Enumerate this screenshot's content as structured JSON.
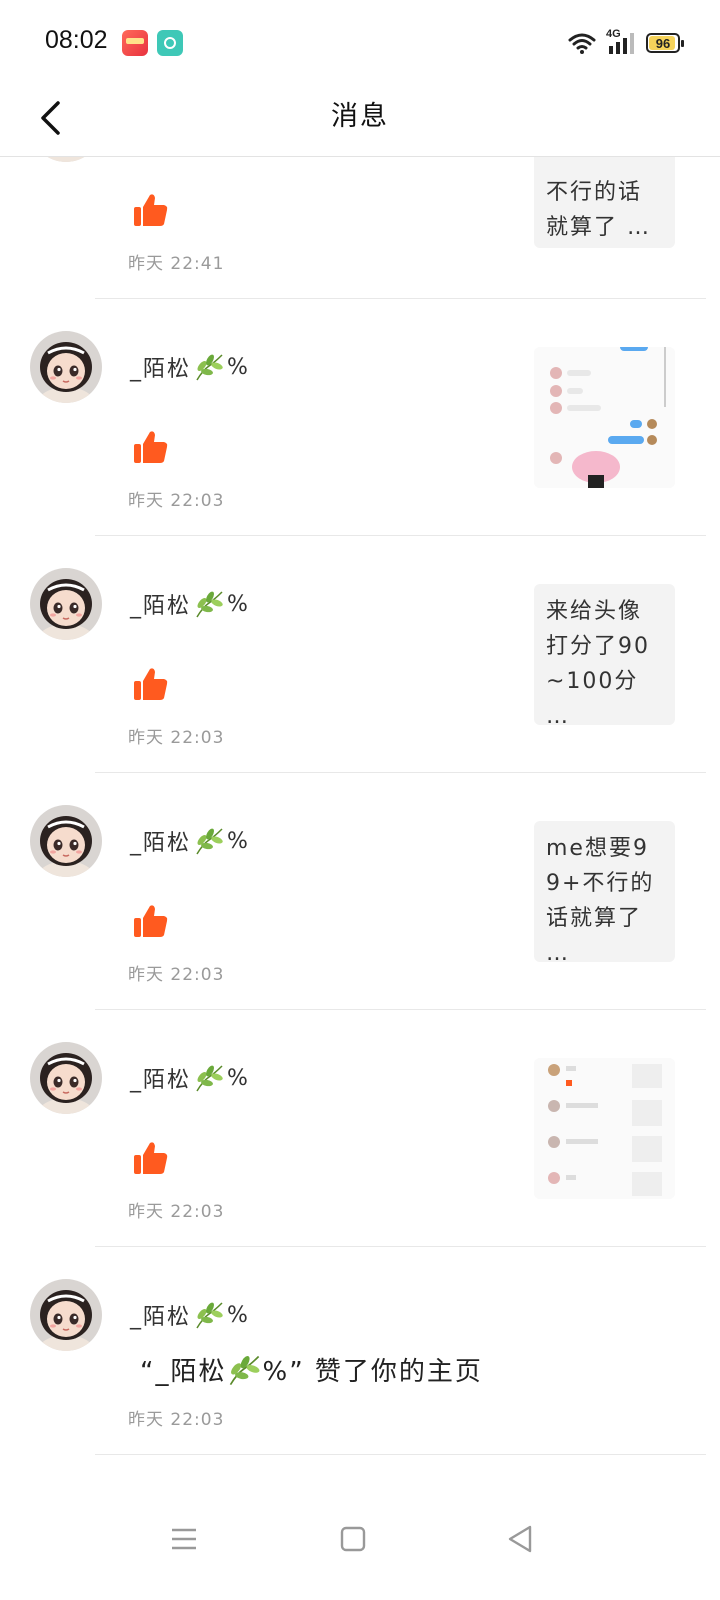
{
  "status_bar": {
    "time": "08:02",
    "network": "4G",
    "battery": "96",
    "icons": [
      "app-icon-1",
      "app-icon-2",
      "wifi-icon",
      "signal-icon",
      "battery-icon"
    ]
  },
  "header": {
    "title": "消息",
    "back_icon": "chevron-left-icon"
  },
  "username": "_陌松",
  "username_suffix": "%",
  "items": [
    {
      "time": "昨天 22:41",
      "thumb_text": "不行的话就算了 …",
      "like": true
    },
    {
      "time": "昨天 22:03",
      "thumb_type": "image",
      "like": true
    },
    {
      "time": "昨天 22:03",
      "thumb_text": "来给头像打分了90~100分 …",
      "like": true
    },
    {
      "time": "昨天 22:03",
      "thumb_text": "me想要99+不行的话就算了 …",
      "like": true
    },
    {
      "time": "昨天 22:03",
      "thumb_type": "image",
      "like": true
    },
    {
      "time": "昨天 22:03",
      "message_prefix": "“_陌松",
      "message_suffix": "%” 赞了你的主页"
    }
  ],
  "navbar": {
    "icons": [
      "menu-icon",
      "home-square-icon",
      "back-triangle-icon"
    ]
  },
  "colors": {
    "like": "#ff5a1f",
    "divider": "#e8e8e8",
    "thumb_bg": "#f3f3f3",
    "time_text": "#9a9a9a"
  }
}
